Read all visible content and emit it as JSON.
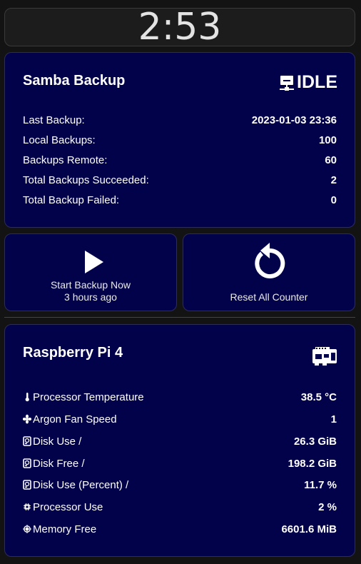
{
  "clock": {
    "time": "2:53"
  },
  "backup": {
    "title": "Samba Backup",
    "state": "IDLE",
    "state_icon": "network-drive-icon",
    "rows": [
      {
        "label": "Last Backup:",
        "value": "2023-01-03 23:36"
      },
      {
        "label": "Local Backups:",
        "value": "100"
      },
      {
        "label": "Backups Remote:",
        "value": "60"
      },
      {
        "label": "Total Backups Succeeded:",
        "value": "2"
      },
      {
        "label": "Total Backup Failed:",
        "value": "0"
      }
    ]
  },
  "actions": {
    "start": {
      "label": "Start Backup Now",
      "sublabel": "3 hours ago",
      "icon": "play-icon"
    },
    "reset": {
      "label": "Reset All Counter",
      "icon": "restart-icon"
    }
  },
  "pi": {
    "title": "Raspberry Pi 4",
    "icon": "raspberry-pi-board-icon",
    "rows": [
      {
        "icon": "thermometer-icon",
        "label": "Processor Temperature",
        "value": "38.5 °C"
      },
      {
        "icon": "fan-icon",
        "label": "Argon Fan Speed",
        "value": "1"
      },
      {
        "icon": "harddisk-icon",
        "label": "Disk Use /",
        "value": "26.3 GiB"
      },
      {
        "icon": "harddisk-icon",
        "label": "Disk Free /",
        "value": "198.2 GiB"
      },
      {
        "icon": "harddisk-icon",
        "label": "Disk Use (Percent) /",
        "value": "11.7 %"
      },
      {
        "icon": "cpu-icon",
        "label": "Processor Use",
        "value": "2 %"
      },
      {
        "icon": "memory-icon",
        "label": "Memory Free",
        "value": "6601.6 MiB"
      }
    ]
  },
  "colors": {
    "card_bg": "#02024a",
    "page_bg": "#131313",
    "text": "#ffffff"
  }
}
